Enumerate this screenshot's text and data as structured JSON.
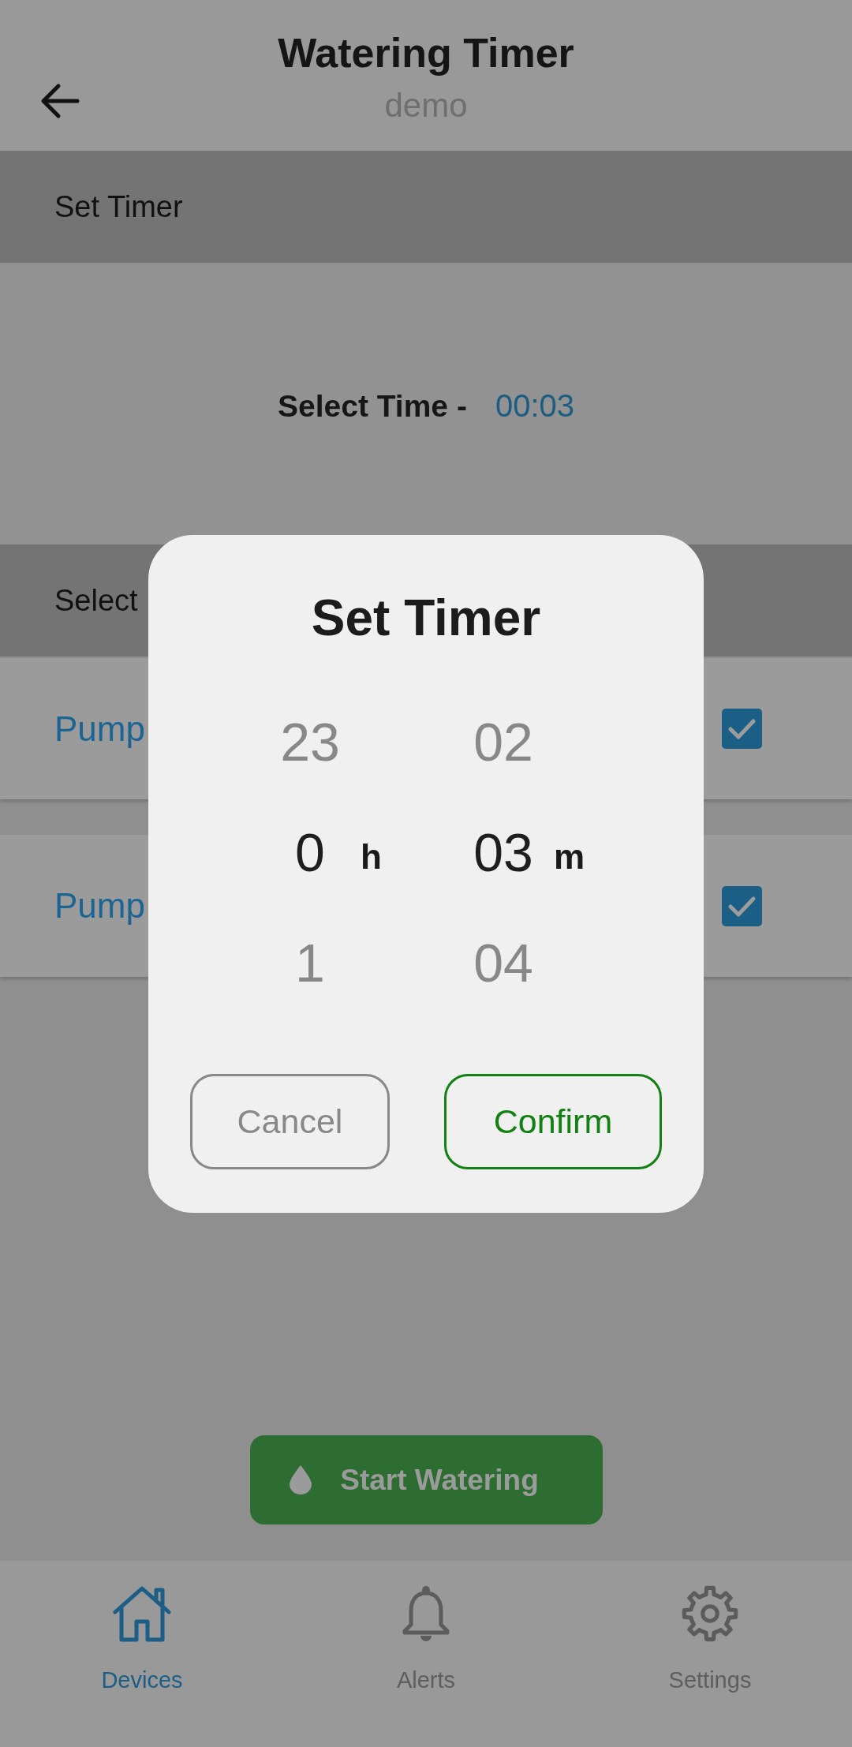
{
  "app_bar": {
    "title": "Watering Timer",
    "subtitle": "demo"
  },
  "sections": [
    {
      "kind": "header",
      "title": "Set Timer"
    },
    {
      "kind": "time",
      "label": "Select Time -",
      "value": "00:03"
    },
    {
      "kind": "header",
      "title": "Select"
    },
    {
      "kind": "pump",
      "label": "Pump",
      "checked": true
    },
    {
      "kind": "pump",
      "label": "Pump",
      "checked": true
    }
  ],
  "action_button": {
    "label": "Start Watering"
  },
  "bottom_nav": [
    {
      "label": "Devices",
      "selected": true
    },
    {
      "label": "Alerts",
      "selected": false
    },
    {
      "label": "Settings",
      "selected": false
    }
  ],
  "dialog": {
    "title": "Set Timer",
    "columns": [
      {
        "unit": "h",
        "values": [
          {
            "text": "23",
            "selected": false
          },
          {
            "text": "0",
            "selected": true
          },
          {
            "text": "1",
            "selected": false
          }
        ]
      },
      {
        "unit": "m",
        "values": [
          {
            "text": "02",
            "selected": false
          },
          {
            "text": "03",
            "selected": true
          },
          {
            "text": "04",
            "selected": false
          }
        ]
      }
    ],
    "buttons": [
      {
        "kind": "cancel",
        "label": "Cancel"
      },
      {
        "kind": "confirm",
        "label": "Confirm"
      }
    ]
  }
}
